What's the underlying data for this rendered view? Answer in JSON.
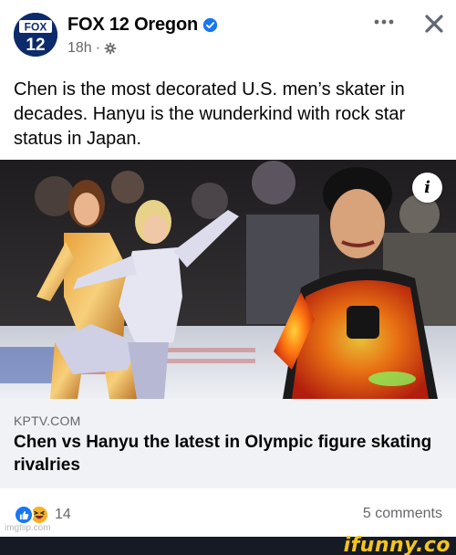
{
  "post": {
    "page_name": "FOX 12 Oregon",
    "avatar_text_top": "FOX",
    "avatar_text_bottom": "12",
    "timestamp": "18h",
    "separator": "·",
    "text": "Chen is the most decorated U.S. men’s skater in decades. Hanyu is the wunderkind with rock star status in Japan."
  },
  "link": {
    "domain": "KPTV.COM",
    "title": "Chen vs Hanyu the latest in Olympic figure skating rivalries",
    "info_label": "i"
  },
  "footer": {
    "reaction_count": "14",
    "comments": "5 comments",
    "watermark": "imgflip.com"
  },
  "brand": {
    "name": "ifunny.co"
  },
  "colors": {
    "facebook_blue": "#1877f2",
    "secondary_text": "#65676b",
    "caption_bg": "#f0f2f5",
    "brand_yellow": "#f5c518"
  },
  "icons": [
    "verified-badge-icon",
    "gear-icon",
    "more-options-icon",
    "close-icon",
    "info-icon",
    "like-reaction-icon",
    "haha-reaction-icon"
  ]
}
